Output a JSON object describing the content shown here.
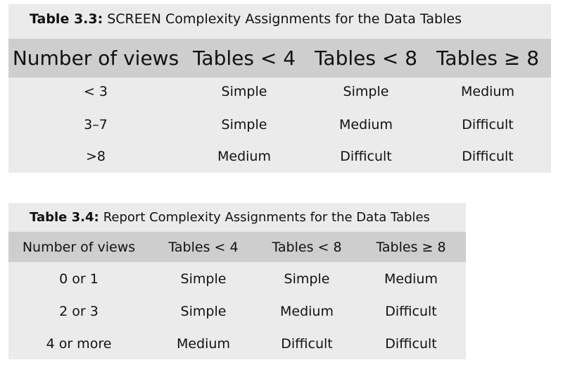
{
  "table1": {
    "caption_label": "Table 3.3:",
    "caption_text": "SCREEN Complexity Assignments for the Data Tables",
    "headers": [
      "Number of views",
      "Tables < 4",
      "Tables < 8",
      "Tables ≥ 8"
    ],
    "rows": [
      [
        "< 3",
        "Simple",
        "Simple",
        "Medium"
      ],
      [
        "3–7",
        "Simple",
        "Medium",
        "Difficult"
      ],
      [
        ">8",
        "Medium",
        "Difficult",
        "Difficult"
      ]
    ]
  },
  "table2": {
    "caption_label": "Table 3.4:",
    "caption_text": "Report Complexity Assignments for the Data Tables",
    "headers": [
      "Number of views",
      "Tables < 4",
      "Tables < 8",
      "Tables ≥ 8"
    ],
    "rows": [
      [
        "0 or 1",
        "Simple",
        "Simple",
        "Medium"
      ],
      [
        "2 or 3",
        "Simple",
        "Medium",
        "Difficult"
      ],
      [
        "4 or more",
        "Medium",
        "Difficult",
        "Difficult"
      ]
    ]
  }
}
